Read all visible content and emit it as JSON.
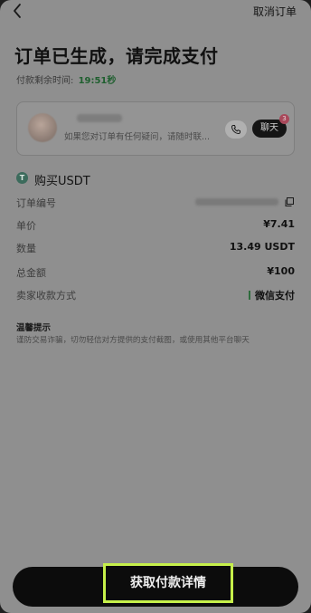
{
  "header": {
    "back_icon": "chevron-left-icon",
    "cancel_label": "取消订单"
  },
  "page": {
    "title": "订单已生成，请完成支付",
    "timer_label": "付款剩余时间:",
    "timer_value": "19:51秒"
  },
  "seller": {
    "message": "如果您对订单有任何疑问，请随时联...",
    "phone_icon": "phone-icon",
    "chat_label": "聊天",
    "unread_count": "3"
  },
  "order": {
    "buy_icon_letter": "T",
    "buy_label": "购买USDT",
    "rows": [
      {
        "key": "订单编号",
        "value": ""
      },
      {
        "key": "单价",
        "value": "¥7.41"
      },
      {
        "key": "数量",
        "value": "13.49 USDT"
      },
      {
        "key": "总金额",
        "value": "¥100"
      },
      {
        "key": "卖家收款方式",
        "value": "微信支付"
      }
    ]
  },
  "tips": {
    "title": "温馨提示",
    "text": "谨防交易诈骗，切勿轻信对方提供的支付截图，或使用其他平台聊天"
  },
  "cta": {
    "label": "获取付款详情",
    "highlight_color": "#c6f04a"
  }
}
